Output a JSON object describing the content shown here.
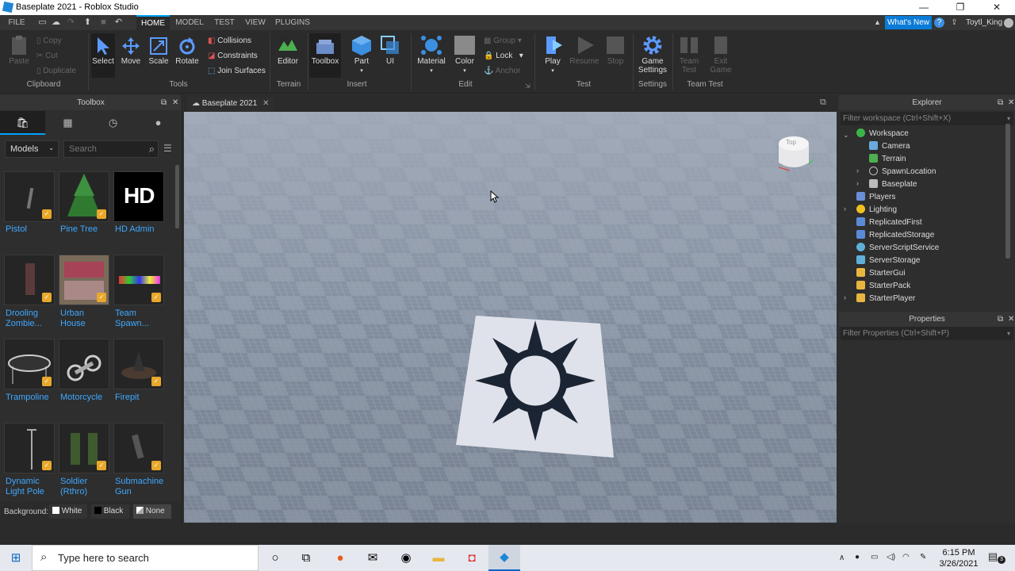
{
  "window": {
    "title": "Baseplate 2021 - Roblox Studio",
    "minimize": "—",
    "maximize": "❐",
    "close": "✕"
  },
  "menu": {
    "items": [
      "FILE",
      "HOME",
      "MODEL",
      "TEST",
      "VIEW",
      "PLUGINS"
    ],
    "active": "HOME",
    "whats_new": "What's New",
    "user": "Toytl_King"
  },
  "ribbon": {
    "clipboard": {
      "paste": "Paste",
      "copy": "Copy",
      "cut": "Cut",
      "duplicate": "Duplicate",
      "group": "Clipboard"
    },
    "tools": {
      "select": "Select",
      "move": "Move",
      "scale": "Scale",
      "rotate": "Rotate",
      "collisions": "Collisions",
      "constraints": "Constraints",
      "join_surfaces": "Join Surfaces",
      "group": "Tools"
    },
    "terrain": {
      "editor": "Editor",
      "group": "Terrain"
    },
    "insert": {
      "toolbox": "Toolbox",
      "part": "Part",
      "ui": "UI",
      "group": "Insert"
    },
    "edit": {
      "material": "Material",
      "color": "Color",
      "group_btn": "Group",
      "lock": "Lock",
      "anchor": "Anchor",
      "group": "Edit"
    },
    "test": {
      "play": "Play",
      "resume": "Resume",
      "stop": "Stop",
      "group": "Test"
    },
    "settings": {
      "game_settings_1": "Game",
      "game_settings_2": "Settings",
      "group": "Settings"
    },
    "team_test": {
      "team_test_1": "Team",
      "team_test_2": "Test",
      "exit_game_1": "Exit",
      "exit_game_2": "Game",
      "group": "Team Test"
    }
  },
  "toolbox": {
    "title": "Toolbox",
    "category": "Models",
    "search_placeholder": "Search",
    "items": [
      {
        "name1": "Pistol",
        "name2": ""
      },
      {
        "name1": "Pine Tree",
        "name2": ""
      },
      {
        "name1": "HD Admin",
        "name2": ""
      },
      {
        "name1": "Drooling",
        "name2": "Zombie..."
      },
      {
        "name1": "Urban",
        "name2": "House"
      },
      {
        "name1": "Team",
        "name2": "Spawn..."
      },
      {
        "name1": "Trampoline",
        "name2": ""
      },
      {
        "name1": "Motorcycle",
        "name2": ""
      },
      {
        "name1": "Firepit",
        "name2": ""
      },
      {
        "name1": "Dynamic",
        "name2": "Light Pole"
      },
      {
        "name1": "Soldier",
        "name2": "(Rthro)"
      },
      {
        "name1": "Submachine",
        "name2": "Gun"
      }
    ],
    "hd_logo": "HD",
    "background_label": "Background:",
    "bg_options": [
      "White",
      "Black",
      "None"
    ]
  },
  "viewport": {
    "tab": "Baseplate 2021",
    "viewcube": "Top"
  },
  "explorer": {
    "title": "Explorer",
    "filter_placeholder": "Filter workspace (Ctrl+Shift+X)",
    "items": [
      "Workspace",
      "Camera",
      "Terrain",
      "SpawnLocation",
      "Baseplate",
      "Players",
      "Lighting",
      "ReplicatedFirst",
      "ReplicatedStorage",
      "ServerScriptService",
      "ServerStorage",
      "StarterGui",
      "StarterPack",
      "StarterPlayer"
    ]
  },
  "properties": {
    "title": "Properties",
    "filter_placeholder": "Filter Properties (Ctrl+Shift+P)"
  },
  "taskbar": {
    "search_placeholder": "Type here to search",
    "time": "6:15 PM",
    "date": "3/26/2021",
    "notif": "3"
  },
  "colors": {
    "accent": "#00a2ff",
    "link": "#3ea8ff",
    "panel": "#2e2e2e",
    "ribbon": "#2b2b2b",
    "floor": "#8b96a6"
  }
}
